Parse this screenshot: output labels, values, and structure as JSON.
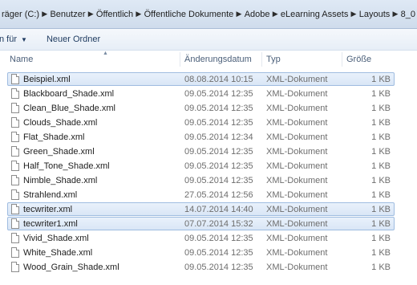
{
  "breadcrumb": [
    "räger (C:)",
    "Benutzer",
    "Öffentlich",
    "Öffentliche Dokumente",
    "Adobe",
    "eLearning Assets",
    "Layouts",
    "8_0"
  ],
  "toolbar": {
    "share_label": "n für",
    "new_folder_label": "Neuer Ordner"
  },
  "columns": {
    "name": "Name",
    "date": "Änderungsdatum",
    "type": "Typ",
    "size": "Größe"
  },
  "files": [
    {
      "name": "Beispiel.xml",
      "date": "08.08.2014 10:15",
      "type": "XML-Dokument",
      "size": "1 KB",
      "selected": true
    },
    {
      "name": "Blackboard_Shade.xml",
      "date": "09.05.2014 12:35",
      "type": "XML-Dokument",
      "size": "1 KB",
      "selected": false
    },
    {
      "name": "Clean_Blue_Shade.xml",
      "date": "09.05.2014 12:35",
      "type": "XML-Dokument",
      "size": "1 KB",
      "selected": false
    },
    {
      "name": "Clouds_Shade.xml",
      "date": "09.05.2014 12:35",
      "type": "XML-Dokument",
      "size": "1 KB",
      "selected": false
    },
    {
      "name": "Flat_Shade.xml",
      "date": "09.05.2014 12:34",
      "type": "XML-Dokument",
      "size": "1 KB",
      "selected": false
    },
    {
      "name": "Green_Shade.xml",
      "date": "09.05.2014 12:35",
      "type": "XML-Dokument",
      "size": "1 KB",
      "selected": false
    },
    {
      "name": "Half_Tone_Shade.xml",
      "date": "09.05.2014 12:35",
      "type": "XML-Dokument",
      "size": "1 KB",
      "selected": false
    },
    {
      "name": "Nimble_Shade.xml",
      "date": "09.05.2014 12:35",
      "type": "XML-Dokument",
      "size": "1 KB",
      "selected": false
    },
    {
      "name": "Strahlend.xml",
      "date": "27.05.2014 12:56",
      "type": "XML-Dokument",
      "size": "1 KB",
      "selected": false
    },
    {
      "name": "tecwriter.xml",
      "date": "14.07.2014 14:40",
      "type": "XML-Dokument",
      "size": "1 KB",
      "selected": true
    },
    {
      "name": "tecwriter1.xml",
      "date": "07.07.2014 15:32",
      "type": "XML-Dokument",
      "size": "1 KB",
      "selected": true
    },
    {
      "name": "Vivid_Shade.xml",
      "date": "09.05.2014 12:35",
      "type": "XML-Dokument",
      "size": "1 KB",
      "selected": false
    },
    {
      "name": "White_Shade.xml",
      "date": "09.05.2014 12:35",
      "type": "XML-Dokument",
      "size": "1 KB",
      "selected": false
    },
    {
      "name": "Wood_Grain_Shade.xml",
      "date": "09.05.2014 12:35",
      "type": "XML-Dokument",
      "size": "1 KB",
      "selected": false
    }
  ]
}
